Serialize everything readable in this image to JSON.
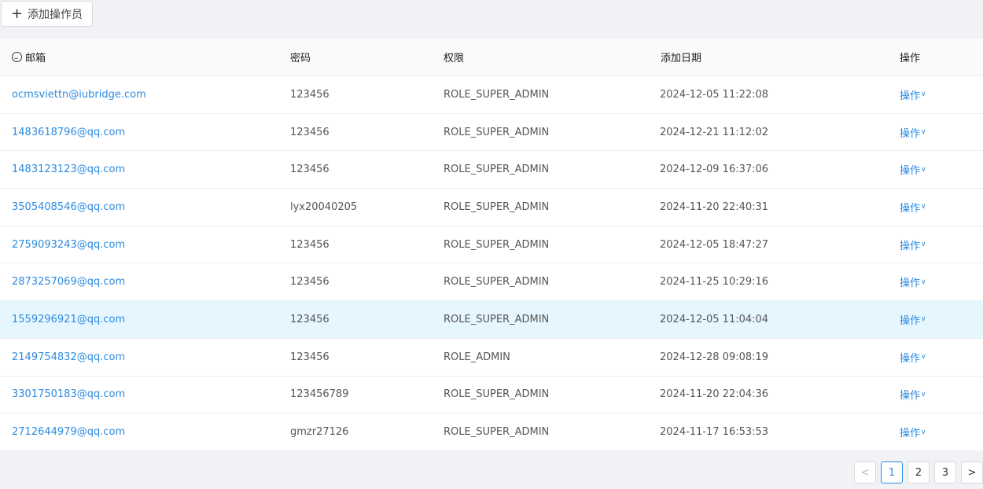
{
  "toolbar": {
    "add_label": "添加操作员"
  },
  "table": {
    "headers": [
      "邮箱",
      "密码",
      "权限",
      "添加日期",
      "操作"
    ],
    "rows": [
      {
        "email": "ocmsviettn@iubridge.com",
        "password": "123456",
        "role": "ROLE_SUPER_ADMIN",
        "date": "2024-12-05 11:22:08",
        "action": "操作"
      },
      {
        "email": "1483618796@qq.com",
        "password": "123456",
        "role": "ROLE_SUPER_ADMIN",
        "date": "2024-12-21 11:12:02",
        "action": "操作"
      },
      {
        "email": "1483123123@qq.com",
        "password": "123456",
        "role": "ROLE_SUPER_ADMIN",
        "date": "2024-12-09 16:37:06",
        "action": "操作"
      },
      {
        "email": "3505408546@qq.com",
        "password": "lyx20040205",
        "role": "ROLE_SUPER_ADMIN",
        "date": "2024-11-20 22:40:31",
        "action": "操作"
      },
      {
        "email": "2759093243@qq.com",
        "password": "123456",
        "role": "ROLE_SUPER_ADMIN",
        "date": "2024-12-05 18:47:27",
        "action": "操作"
      },
      {
        "email": "2873257069@qq.com",
        "password": "123456",
        "role": "ROLE_SUPER_ADMIN",
        "date": "2024-11-25 10:29:16",
        "action": "操作"
      },
      {
        "email": "1559296921@qq.com",
        "password": "123456",
        "role": "ROLE_SUPER_ADMIN",
        "date": "2024-12-05 11:04:04",
        "action": "操作"
      },
      {
        "email": "2149754832@qq.com",
        "password": "123456",
        "role": "ROLE_ADMIN",
        "date": "2024-12-28 09:08:19",
        "action": "操作"
      },
      {
        "email": "3301750183@qq.com",
        "password": "123456789",
        "role": "ROLE_SUPER_ADMIN",
        "date": "2024-11-20 22:04:36",
        "action": "操作"
      },
      {
        "email": "2712644979@qq.com",
        "password": "gmzr27126",
        "role": "ROLE_SUPER_ADMIN",
        "date": "2024-11-17 16:53:53",
        "action": "操作"
      }
    ]
  },
  "pagination": {
    "pages": [
      "1",
      "2",
      "3"
    ],
    "current": "1",
    "prev": "<",
    "next": ">"
  },
  "colors": {
    "link": "#2c8be0",
    "highlight_row": "#e6f6fe"
  },
  "icons": {
    "add": "plus-icon",
    "email_header": "smile-icon",
    "dropdown": "chevron-down-icon"
  }
}
